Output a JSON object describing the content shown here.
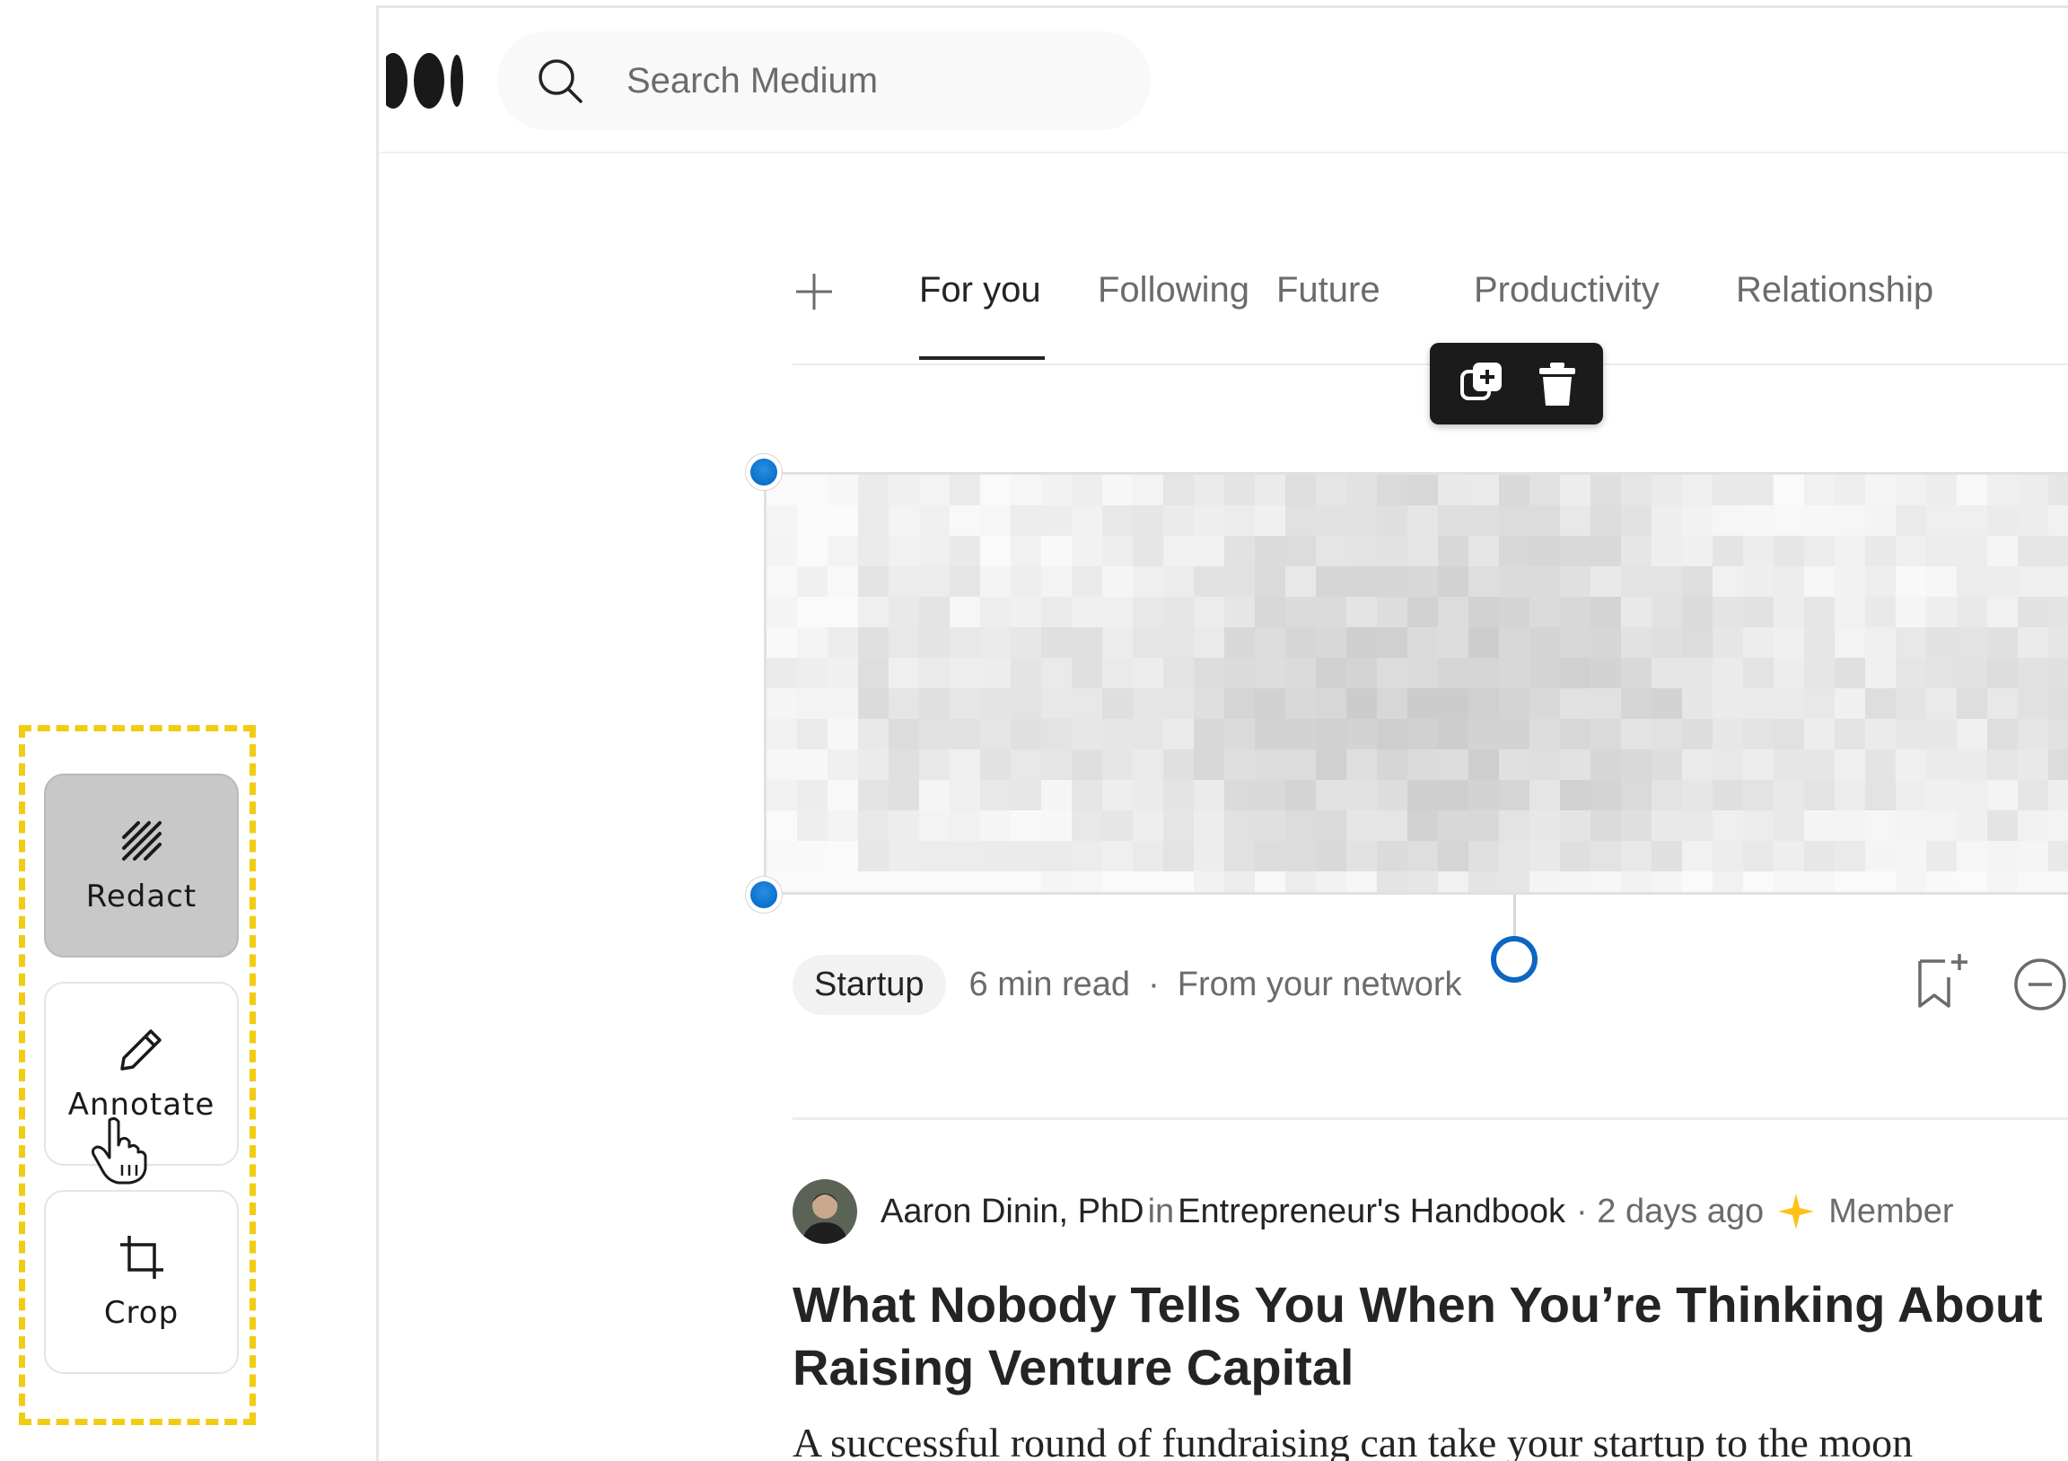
{
  "tools": {
    "redact_label": "Redact",
    "annotate_label": "Annotate",
    "crop_label": "Crop",
    "active": "redact",
    "icons": [
      "redact-hatch-icon",
      "pencil-icon",
      "crop-icon"
    ]
  },
  "header": {
    "logo_icon": "medium-logo-icon",
    "search_placeholder": "Search Medium"
  },
  "tabs": {
    "items": [
      "For you",
      "Following",
      "Future",
      "Productivity",
      "Relationship"
    ],
    "active": "For you"
  },
  "floating_toolbar": {
    "icons": [
      "duplicate-icon",
      "trash-icon"
    ]
  },
  "post": {
    "tag": "Startup",
    "read_time": "6 min read",
    "separator": "·",
    "source": "From your network"
  },
  "article": {
    "author": "Aaron Dinin, PhD",
    "in_word": "in",
    "publication": "Entrepreneur's Handbook",
    "date_text": "· 2 days ago",
    "member_text": "Member",
    "title_line1": "What Nobody Tells You When You’re Thinking About",
    "title_line2": "Raising Venture Capital",
    "snippet": "A successful round of fundraising can take your startup to the moon"
  },
  "colors": {
    "accent_yellow": "#f2cc12",
    "handle_blue": "#0a70cc",
    "star_gold": "#ffc017",
    "text": "#242424",
    "muted": "#6b6b6b"
  }
}
